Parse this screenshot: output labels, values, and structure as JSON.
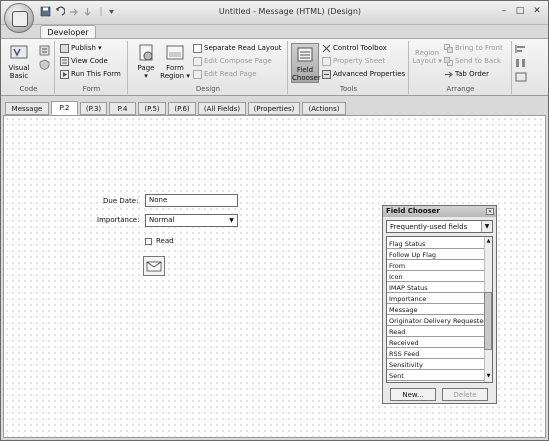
{
  "window": {
    "title": "Untitled - Message (HTML)  (Design)"
  },
  "ribbon": {
    "active_tab": "Developer",
    "groups": {
      "code": {
        "label": "Code",
        "visual_basic": "Visual Basic"
      },
      "form": {
        "label": "Form",
        "publish": "Publish",
        "view_code": "View Code",
        "run_this_form": "Run This Form"
      },
      "design": {
        "label": "Design",
        "page": "Page",
        "form_region": "Form Region",
        "separate_read_layout": "Separate Read Layout",
        "edit_compose_page": "Edit Compose Page",
        "edit_read_page": "Edit Read Page"
      },
      "tools": {
        "label": "Tools",
        "field_chooser": "Field Chooser",
        "control_toolbox": "Control Toolbox",
        "property_sheet": "Property Sheet",
        "advanced_properties": "Advanced Properties"
      },
      "arrange": {
        "label": "Arrange",
        "region_layout": "Region Layout",
        "bring_to_front": "Bring to Front",
        "send_to_back": "Send to Back",
        "tab_order": "Tab Order"
      }
    }
  },
  "page_tabs": [
    "Message",
    "P.2",
    "(P.3)",
    "P.4",
    "(P.5)",
    "(P.6)",
    "(All Fields)",
    "(Properties)",
    "(Actions)"
  ],
  "form": {
    "due_date_label": "Due Date:",
    "due_date_value": "None",
    "importance_label": "Importance:",
    "importance_value": "Normal",
    "read_label": "Read"
  },
  "field_chooser": {
    "title": "Field Chooser",
    "category": "Frequently-used fields",
    "fields": [
      "Flag Status",
      "Follow Up Flag",
      "From",
      "Icon",
      "IMAP Status",
      "Importance",
      "Message",
      "Originator Delivery Requested",
      "Read",
      "Received",
      "RSS Feed",
      "Sensitivity",
      "Sent"
    ],
    "new_button": "New...",
    "delete_button": "Delete"
  }
}
